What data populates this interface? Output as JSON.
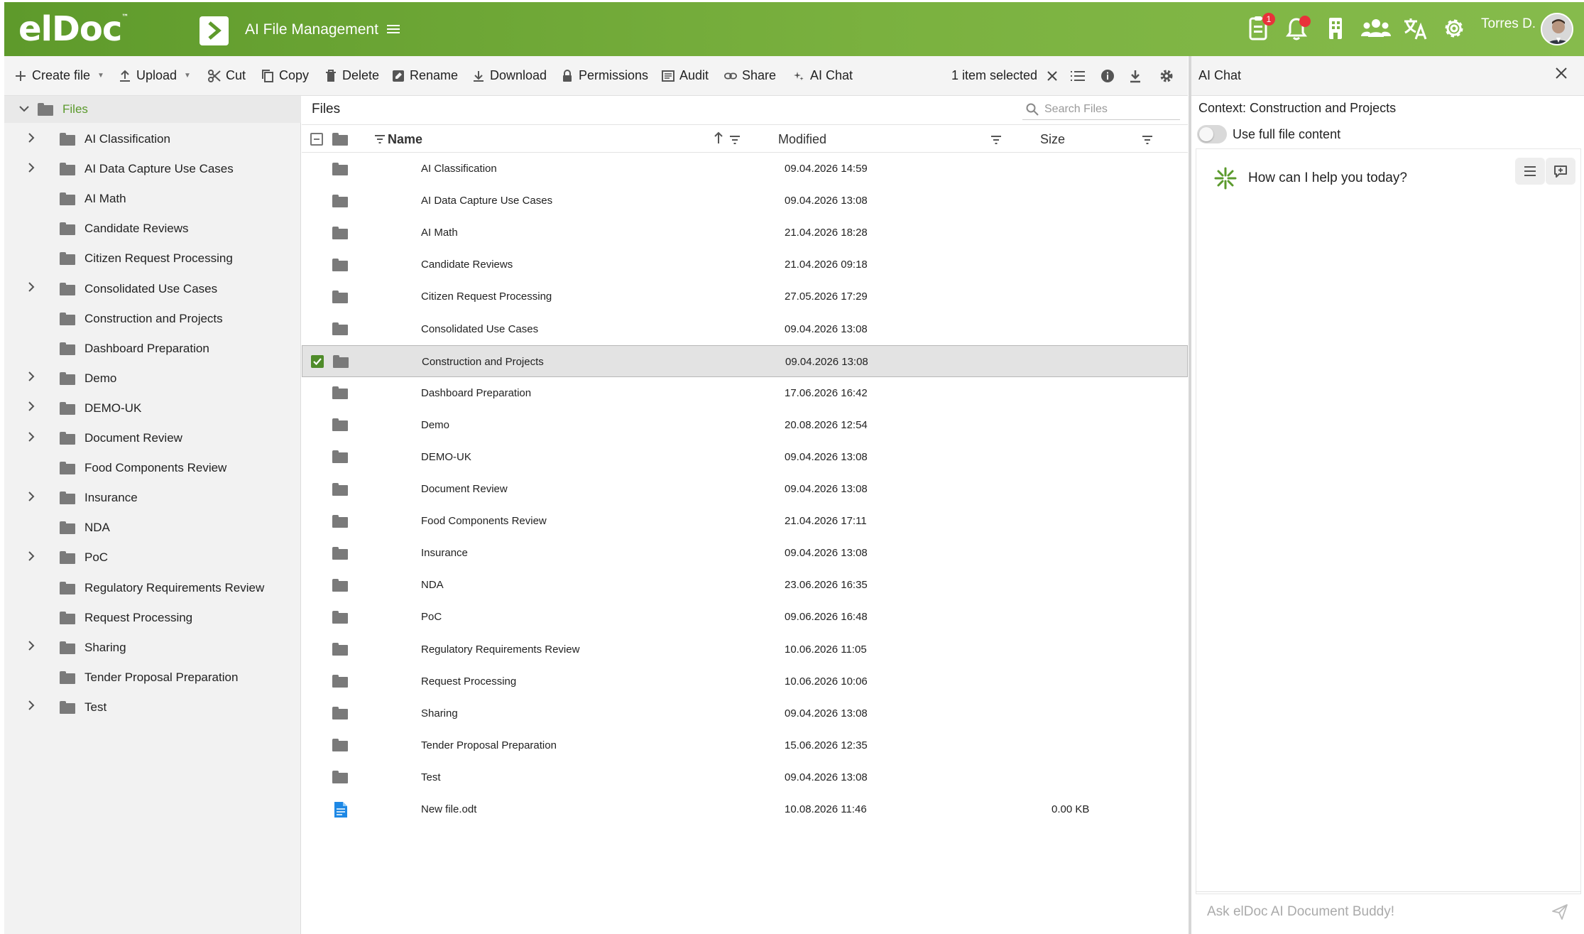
{
  "header": {
    "logo": "elDoc",
    "logo_tm": "™",
    "app_title": "AI File Management",
    "tasks_badge": "1",
    "username": "Torres D."
  },
  "toolbar": {
    "create_file": "Create file",
    "upload": "Upload",
    "cut": "Cut",
    "copy": "Copy",
    "delete": "Delete",
    "rename": "Rename",
    "download": "Download",
    "permissions": "Permissions",
    "audit": "Audit",
    "share": "Share",
    "ai_chat": "AI Chat",
    "selection": "1 item selected"
  },
  "tree": {
    "root": "Files",
    "items": [
      {
        "label": "AI Classification",
        "expandable": true
      },
      {
        "label": "AI Data Capture Use Cases",
        "expandable": true
      },
      {
        "label": "AI Math",
        "expandable": false
      },
      {
        "label": "Candidate Reviews",
        "expandable": false
      },
      {
        "label": "Citizen Request Processing",
        "expandable": false
      },
      {
        "label": "Consolidated Use Cases",
        "expandable": true
      },
      {
        "label": "Construction and Projects",
        "expandable": false
      },
      {
        "label": "Dashboard Preparation",
        "expandable": false
      },
      {
        "label": "Demo",
        "expandable": true
      },
      {
        "label": "DEMO-UK",
        "expandable": true
      },
      {
        "label": "Document Review",
        "expandable": true
      },
      {
        "label": "Food Components Review",
        "expandable": false
      },
      {
        "label": "Insurance",
        "expandable": true
      },
      {
        "label": "NDA",
        "expandable": false
      },
      {
        "label": "PoC",
        "expandable": true
      },
      {
        "label": "Regulatory Requirements Review",
        "expandable": false
      },
      {
        "label": "Request Processing",
        "expandable": false
      },
      {
        "label": "Sharing",
        "expandable": true
      },
      {
        "label": "Tender Proposal Preparation",
        "expandable": false
      },
      {
        "label": "Test",
        "expandable": true
      }
    ]
  },
  "main": {
    "title": "Files",
    "search_placeholder": "Search Files",
    "columns": {
      "name": "Name",
      "modified": "Modified",
      "size": "Size"
    },
    "rows": [
      {
        "name": "AI Classification",
        "modified": "09.04.2026 14:59",
        "size": "",
        "type": "folder",
        "selected": false
      },
      {
        "name": "AI Data Capture Use Cases",
        "modified": "09.04.2026 13:08",
        "size": "",
        "type": "folder",
        "selected": false
      },
      {
        "name": "AI Math",
        "modified": "21.04.2026 18:28",
        "size": "",
        "type": "folder",
        "selected": false
      },
      {
        "name": "Candidate Reviews",
        "modified": "21.04.2026 09:18",
        "size": "",
        "type": "folder",
        "selected": false
      },
      {
        "name": "Citizen Request Processing",
        "modified": "27.05.2026 17:29",
        "size": "",
        "type": "folder",
        "selected": false
      },
      {
        "name": "Consolidated Use Cases",
        "modified": "09.04.2026 13:08",
        "size": "",
        "type": "folder",
        "selected": false
      },
      {
        "name": "Construction and Projects",
        "modified": "09.04.2026 13:08",
        "size": "",
        "type": "folder",
        "selected": true
      },
      {
        "name": "Dashboard Preparation",
        "modified": "17.06.2026 16:42",
        "size": "",
        "type": "folder",
        "selected": false
      },
      {
        "name": "Demo",
        "modified": "20.08.2026 12:54",
        "size": "",
        "type": "folder",
        "selected": false
      },
      {
        "name": "DEMO-UK",
        "modified": "09.04.2026 13:08",
        "size": "",
        "type": "folder",
        "selected": false
      },
      {
        "name": "Document Review",
        "modified": "09.04.2026 13:08",
        "size": "",
        "type": "folder",
        "selected": false
      },
      {
        "name": "Food Components Review",
        "modified": "21.04.2026 17:11",
        "size": "",
        "type": "folder",
        "selected": false
      },
      {
        "name": "Insurance",
        "modified": "09.04.2026 13:08",
        "size": "",
        "type": "folder",
        "selected": false
      },
      {
        "name": "NDA",
        "modified": "23.06.2026 16:35",
        "size": "",
        "type": "folder",
        "selected": false
      },
      {
        "name": "PoC",
        "modified": "09.06.2026 16:48",
        "size": "",
        "type": "folder",
        "selected": false
      },
      {
        "name": "Regulatory Requirements Review",
        "modified": "10.06.2026 11:05",
        "size": "",
        "type": "folder",
        "selected": false
      },
      {
        "name": "Request Processing",
        "modified": "10.06.2026 10:06",
        "size": "",
        "type": "folder",
        "selected": false
      },
      {
        "name": "Sharing",
        "modified": "09.04.2026 13:08",
        "size": "",
        "type": "folder",
        "selected": false
      },
      {
        "name": "Tender Proposal Preparation",
        "modified": "15.06.2026 12:35",
        "size": "",
        "type": "folder",
        "selected": false
      },
      {
        "name": "Test",
        "modified": "09.04.2026 13:08",
        "size": "",
        "type": "folder",
        "selected": false
      },
      {
        "name": "New file.odt",
        "modified": "10.08.2026 11:46",
        "size": "0.00 KB",
        "type": "document",
        "selected": false
      }
    ]
  },
  "chat": {
    "title": "AI Chat",
    "context": "Context: Construction and Projects",
    "toggle_label": "Use full file content",
    "greeting": "How can I help you today?",
    "input_placeholder": "Ask elDoc AI Document Buddy!"
  },
  "colors": {
    "brand_green": "#6fa836",
    "selected_check": "#4f8c2a",
    "folder_grey": "#7a7a7a",
    "doc_blue": "#1e88e5",
    "badge_red": "#e8323a"
  }
}
